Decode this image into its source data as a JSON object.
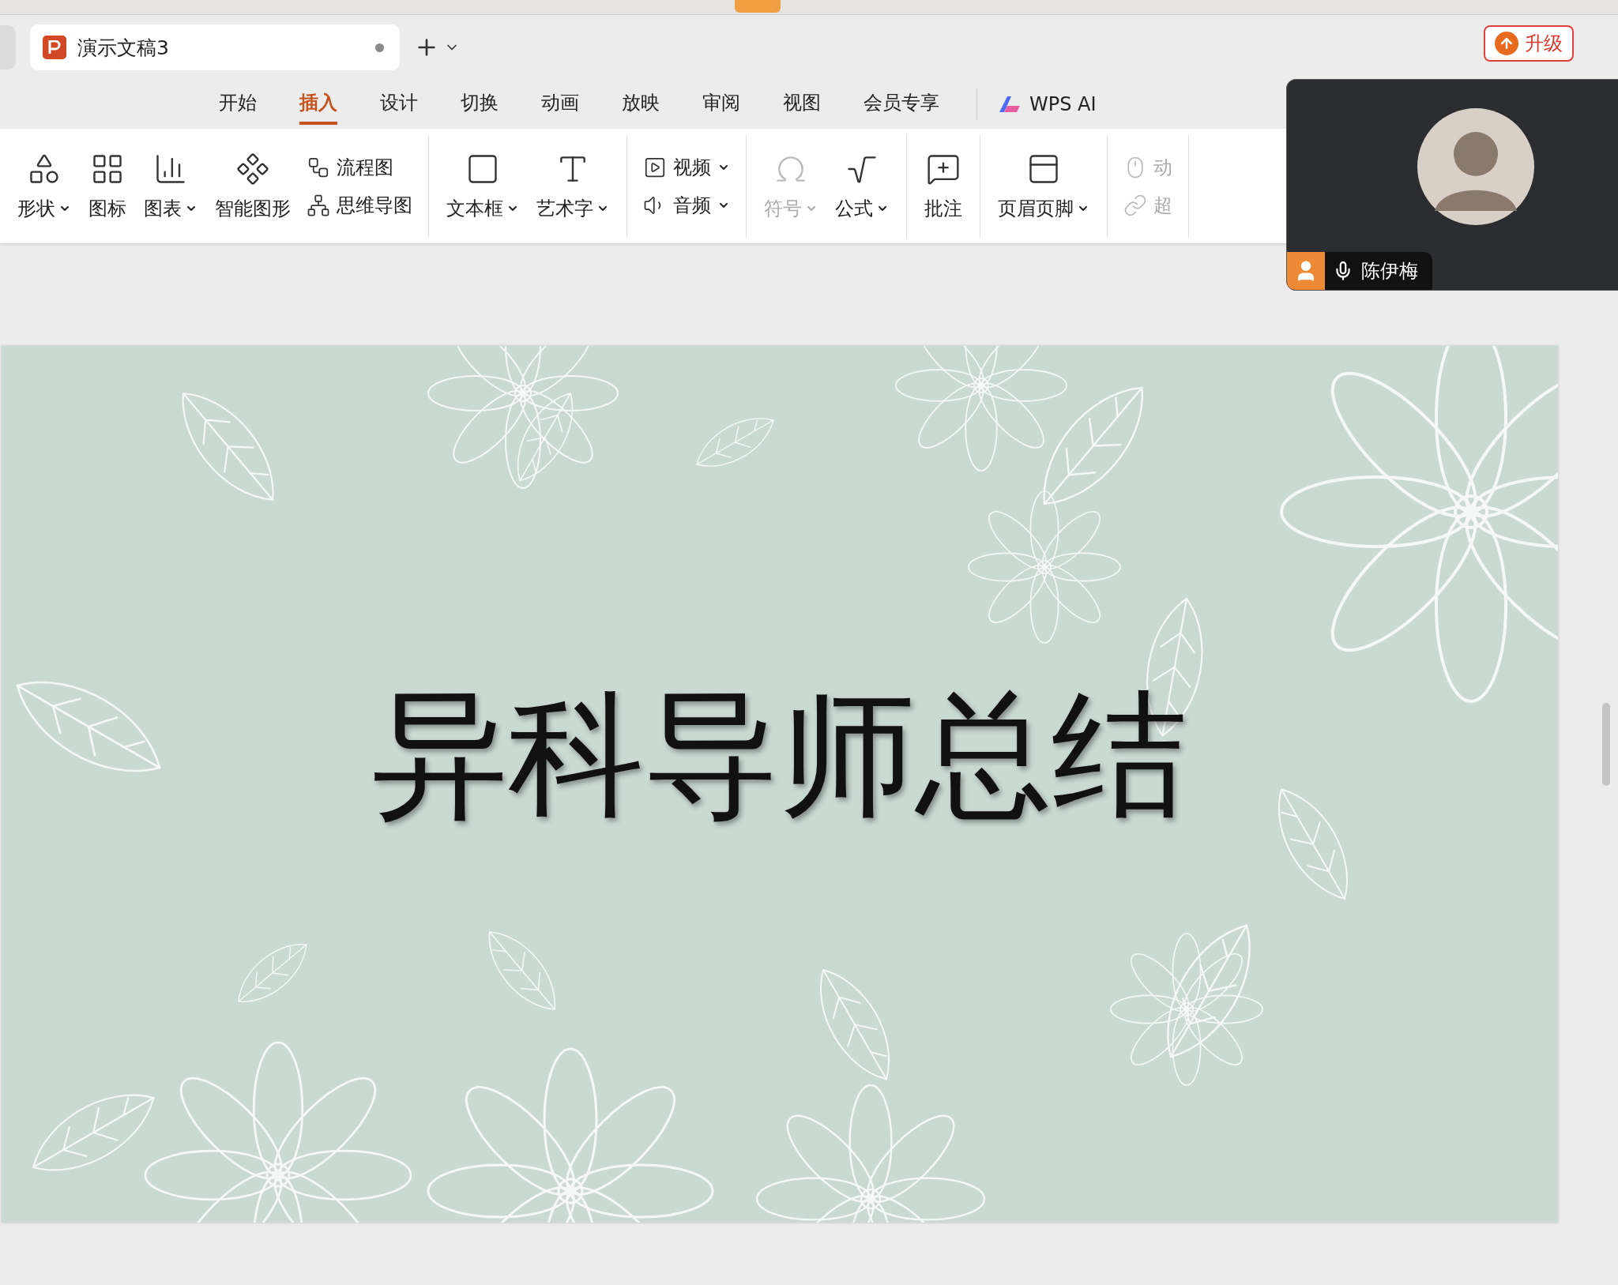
{
  "document_tab": {
    "title": "演示文稿3",
    "unsaved": true
  },
  "upgrade_button": "升级",
  "ribbon_tabs": [
    {
      "label": "开始",
      "selected": false
    },
    {
      "label": "插入",
      "selected": true
    },
    {
      "label": "设计",
      "selected": false
    },
    {
      "label": "切换",
      "selected": false
    },
    {
      "label": "动画",
      "selected": false
    },
    {
      "label": "放映",
      "selected": false
    },
    {
      "label": "审阅",
      "selected": false
    },
    {
      "label": "视图",
      "selected": false
    },
    {
      "label": "会员专享",
      "selected": false
    }
  ],
  "ai_tab": "WPS AI",
  "tool_groups": [
    [
      {
        "kind": "large",
        "label": "形状",
        "dropdown": true,
        "disabled": false
      },
      {
        "kind": "large",
        "label": "图标",
        "dropdown": false,
        "disabled": false
      },
      {
        "kind": "large",
        "label": "图表",
        "dropdown": true,
        "disabled": false
      },
      {
        "kind": "large",
        "label": "智能图形",
        "dropdown": false,
        "disabled": false
      },
      {
        "kind": "small",
        "label": "流程图",
        "dropdown": false,
        "disabled": false
      },
      {
        "kind": "small",
        "label": "思维导图",
        "dropdown": false,
        "disabled": false
      }
    ],
    [
      {
        "kind": "large",
        "label": "文本框",
        "dropdown": true,
        "disabled": false
      },
      {
        "kind": "large",
        "label": "艺术字",
        "dropdown": true,
        "disabled": false
      }
    ],
    [
      {
        "kind": "small",
        "label": "视频",
        "dropdown": true,
        "disabled": false
      },
      {
        "kind": "small",
        "label": "音频",
        "dropdown": true,
        "disabled": false
      }
    ],
    [
      {
        "kind": "large",
        "label": "符号",
        "dropdown": true,
        "disabled": true
      },
      {
        "kind": "large",
        "label": "公式",
        "dropdown": true,
        "disabled": false
      }
    ],
    [
      {
        "kind": "large",
        "label": "批注",
        "dropdown": false,
        "disabled": false
      }
    ],
    [
      {
        "kind": "large",
        "label": "页眉页脚",
        "dropdown": true,
        "disabled": false
      }
    ],
    [
      {
        "kind": "small",
        "label": "动",
        "dropdown": false,
        "disabled": true
      },
      {
        "kind": "small",
        "label": "超",
        "dropdown": false,
        "disabled": true
      }
    ]
  ],
  "call_overlay": {
    "participant": "陈伊梅"
  },
  "slide": {
    "title": "异科导师总结"
  }
}
